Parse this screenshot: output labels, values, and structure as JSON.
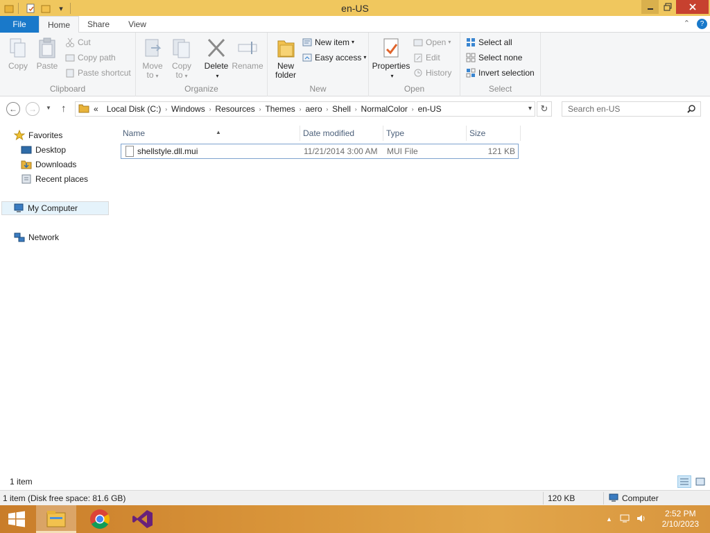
{
  "window": {
    "title": "en-US"
  },
  "tabs": {
    "file": "File",
    "home": "Home",
    "share": "Share",
    "view": "View"
  },
  "ribbon": {
    "clipboard": {
      "copy": "Copy",
      "paste": "Paste",
      "cut": "Cut",
      "copy_path": "Copy path",
      "paste_shortcut": "Paste shortcut",
      "group": "Clipboard"
    },
    "organize": {
      "move_to_1": "Move",
      "move_to_2": "to",
      "copy_to_1": "Copy",
      "copy_to_2": "to",
      "delete": "Delete",
      "rename": "Rename",
      "group": "Organize"
    },
    "new": {
      "new_folder_1": "New",
      "new_folder_2": "folder",
      "new_item": "New item",
      "easy_access": "Easy access",
      "group": "New"
    },
    "open": {
      "properties": "Properties",
      "open": "Open",
      "edit": "Edit",
      "history": "History",
      "group": "Open"
    },
    "select": {
      "select_all": "Select all",
      "select_none": "Select none",
      "invert_selection": "Invert selection",
      "group": "Select"
    }
  },
  "address": {
    "overflow": "«",
    "crumbs": [
      "Local Disk (C:)",
      "Windows",
      "Resources",
      "Themes",
      "aero",
      "Shell",
      "NormalColor",
      "en-US"
    ],
    "search_placeholder": "Search en-US"
  },
  "nav": {
    "favorites": "Favorites",
    "desktop": "Desktop",
    "downloads": "Downloads",
    "recent_places": "Recent places",
    "my_computer": "My Computer",
    "network": "Network"
  },
  "columns": {
    "name": "Name",
    "date": "Date modified",
    "type": "Type",
    "size": "Size"
  },
  "files": [
    {
      "name": "shellstyle.dll.mui",
      "date": "11/21/2014 3:00 AM",
      "type": "MUI File",
      "size": "121 KB"
    }
  ],
  "status": {
    "count": "1 item",
    "detail": "1 item (Disk free space: 81.6 GB)",
    "size": "120 KB",
    "computer": "Computer"
  },
  "clock": {
    "time": "2:52 PM",
    "date": "2/10/2023"
  },
  "colors": {
    "title_bar": "#f0c75e",
    "file_tab": "#1979ca",
    "close": "#c7412f",
    "selection_border": "#7da2ce"
  }
}
